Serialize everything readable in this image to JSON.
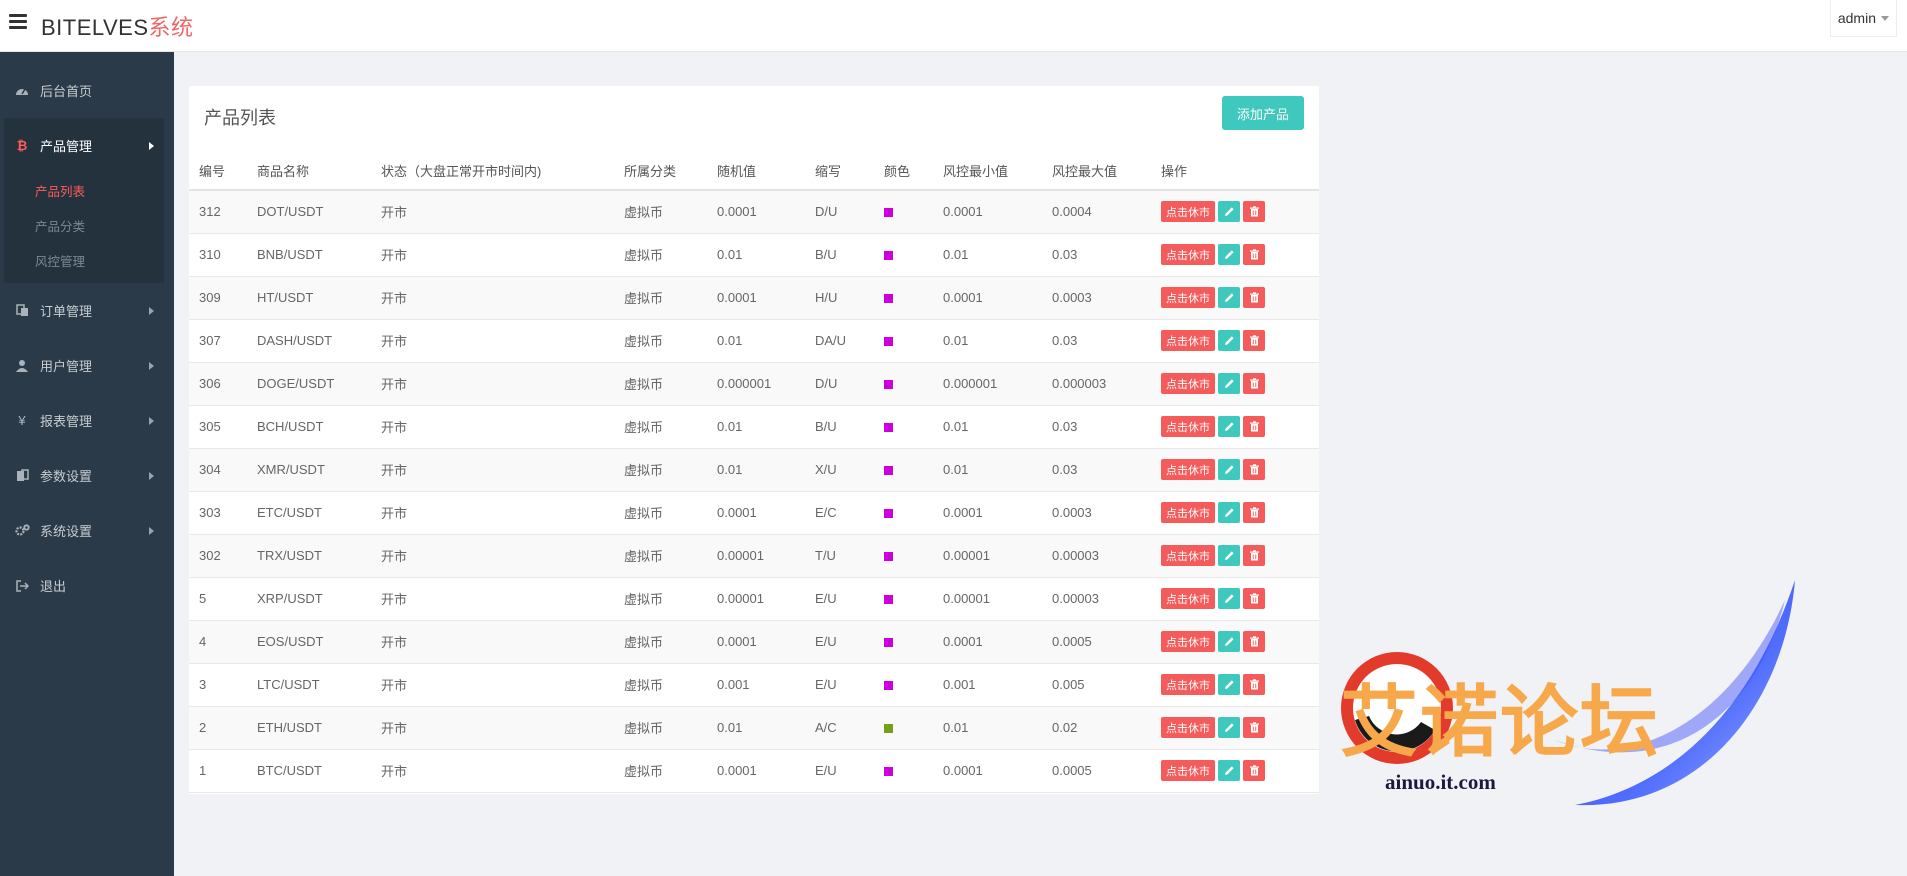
{
  "header": {
    "brand": "BITELVES",
    "brand_accent": "系统",
    "user": "admin"
  },
  "sidebar": {
    "items": [
      {
        "label": "后台首页",
        "icon": "dashboard-icon"
      },
      {
        "label": "产品管理",
        "icon": "bitcoin-icon"
      },
      {
        "label": "订单管理",
        "icon": "copy-icon"
      },
      {
        "label": "用户管理",
        "icon": "user-icon"
      },
      {
        "label": "报表管理",
        "icon": "yen-icon"
      },
      {
        "label": "参数设置",
        "icon": "files-icon"
      },
      {
        "label": "系统设置",
        "icon": "gears-icon"
      },
      {
        "label": "退出",
        "icon": "signout-icon"
      }
    ],
    "submenu": [
      "产品列表",
      "产品分类",
      "风控管理"
    ],
    "active_submenu": "产品列表"
  },
  "panel": {
    "title": "产品列表",
    "add_label": "添加产品"
  },
  "table": {
    "headers": [
      "编号",
      "商品名称",
      "状态（大盘正常开市时间内)",
      "所属分类",
      "随机值",
      "缩写",
      "颜色",
      "风控最小值",
      "风控最大值",
      "操作"
    ],
    "rows": [
      {
        "id": "312",
        "name": "DOT/USDT",
        "status": "开市",
        "category": "虚拟币",
        "random": "0.0001",
        "abbr": "D/U",
        "color": "#cc00dd",
        "min": "0.0001",
        "max": "0.0004"
      },
      {
        "id": "310",
        "name": "BNB/USDT",
        "status": "开市",
        "category": "虚拟币",
        "random": "0.01",
        "abbr": "B/U",
        "color": "#cc00dd",
        "min": "0.01",
        "max": "0.03"
      },
      {
        "id": "309",
        "name": "HT/USDT",
        "status": "开市",
        "category": "虚拟币",
        "random": "0.0001",
        "abbr": "H/U",
        "color": "#cc00dd",
        "min": "0.0001",
        "max": "0.0003"
      },
      {
        "id": "307",
        "name": "DASH/USDT",
        "status": "开市",
        "category": "虚拟币",
        "random": "0.01",
        "abbr": "DA/U",
        "color": "#cc00dd",
        "min": "0.01",
        "max": "0.03"
      },
      {
        "id": "306",
        "name": "DOGE/USDT",
        "status": "开市",
        "category": "虚拟币",
        "random": "0.000001",
        "abbr": "D/U",
        "color": "#cc00dd",
        "min": "0.000001",
        "max": "0.000003"
      },
      {
        "id": "305",
        "name": "BCH/USDT",
        "status": "开市",
        "category": "虚拟币",
        "random": "0.01",
        "abbr": "B/U",
        "color": "#cc00dd",
        "min": "0.01",
        "max": "0.03"
      },
      {
        "id": "304",
        "name": "XMR/USDT",
        "status": "开市",
        "category": "虚拟币",
        "random": "0.01",
        "abbr": "X/U",
        "color": "#cc00dd",
        "min": "0.01",
        "max": "0.03"
      },
      {
        "id": "303",
        "name": "ETC/USDT",
        "status": "开市",
        "category": "虚拟币",
        "random": "0.0001",
        "abbr": "E/C",
        "color": "#cc00dd",
        "min": "0.0001",
        "max": "0.0003"
      },
      {
        "id": "302",
        "name": "TRX/USDT",
        "status": "开市",
        "category": "虚拟币",
        "random": "0.00001",
        "abbr": "T/U",
        "color": "#cc00dd",
        "min": "0.00001",
        "max": "0.00003"
      },
      {
        "id": "5",
        "name": "XRP/USDT",
        "status": "开市",
        "category": "虚拟币",
        "random": "0.00001",
        "abbr": "E/U",
        "color": "#cc00dd",
        "min": "0.00001",
        "max": "0.00003"
      },
      {
        "id": "4",
        "name": "EOS/USDT",
        "status": "开市",
        "category": "虚拟币",
        "random": "0.0001",
        "abbr": "E/U",
        "color": "#cc00dd",
        "min": "0.0001",
        "max": "0.0005"
      },
      {
        "id": "3",
        "name": "LTC/USDT",
        "status": "开市",
        "category": "虚拟币",
        "random": "0.001",
        "abbr": "E/U",
        "color": "#cc00dd",
        "min": "0.001",
        "max": "0.005"
      },
      {
        "id": "2",
        "name": "ETH/USDT",
        "status": "开市",
        "category": "虚拟币",
        "random": "0.01",
        "abbr": "A/C",
        "color": "#77a01a",
        "min": "0.01",
        "max": "0.02"
      },
      {
        "id": "1",
        "name": "BTC/USDT",
        "status": "开市",
        "category": "虚拟币",
        "random": "0.0001",
        "abbr": "E/U",
        "color": "#cc00dd",
        "min": "0.0001",
        "max": "0.0005"
      }
    ],
    "toggle_label": "点击休市"
  },
  "watermark": {
    "text": "艾诺论坛",
    "url": "ainuo.it.com"
  }
}
